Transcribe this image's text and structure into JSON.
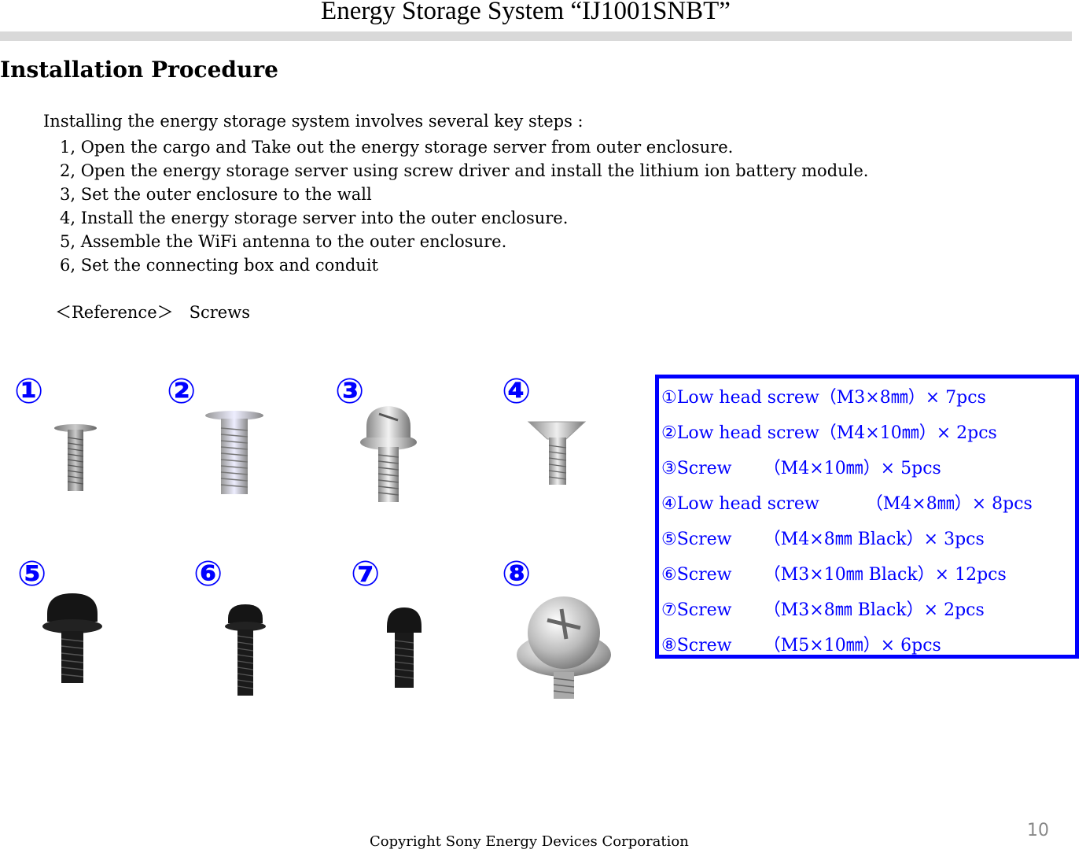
{
  "header": {
    "title": "Energy Storage System “IJ1001SNBT”"
  },
  "section": {
    "heading": "Installation Procedure",
    "intro": "Installing the energy storage system involves several key steps :",
    "steps": [
      "1, Open the cargo and Take out the energy storage server from outer enclosure.",
      "2, Open the energy storage server using screw driver and install the lithium ion battery module.",
      "3, Set the outer enclosure to the wall",
      "4, Install the energy storage server into the outer enclosure.",
      "5, Assemble the WiFi antenna to the outer enclosure.",
      "6, Set the connecting box and conduit"
    ],
    "reference_label": "＜Reference＞",
    "reference_topic": "Screws"
  },
  "screws": {
    "markers": [
      "①",
      "②",
      "③",
      "④",
      "⑤",
      "⑥",
      "⑦",
      "⑧"
    ],
    "legend": [
      {
        "num": "①",
        "name": "Low head screw",
        "spec": "（M3×8㎜）× 7pcs"
      },
      {
        "num": "②",
        "name": "Low head screw",
        "spec": "（M4×10㎜）× 2pcs"
      },
      {
        "num": "③",
        "name": "Screw",
        "spec": "（M4×10㎜）× 5pcs"
      },
      {
        "num": "④",
        "name": "Low head screw",
        "spec": "（M4×8㎜）× 8pcs"
      },
      {
        "num": "⑤",
        "name": "Screw",
        "spec": "（M4×8㎜ Black）× 3pcs"
      },
      {
        "num": "⑥",
        "name": "Screw",
        "spec": "（M3×10㎜ Black）× 12pcs"
      },
      {
        "num": "⑦",
        "name": "Screw",
        "spec": "（M3×8㎜ Black）× 2pcs"
      },
      {
        "num": "⑧",
        "name": "Screw",
        "spec": "（M5×10㎜）× 6pcs"
      }
    ]
  },
  "footer": {
    "copyright": "Copyright Sony Energy Devices Corporation",
    "page_number": "10"
  }
}
